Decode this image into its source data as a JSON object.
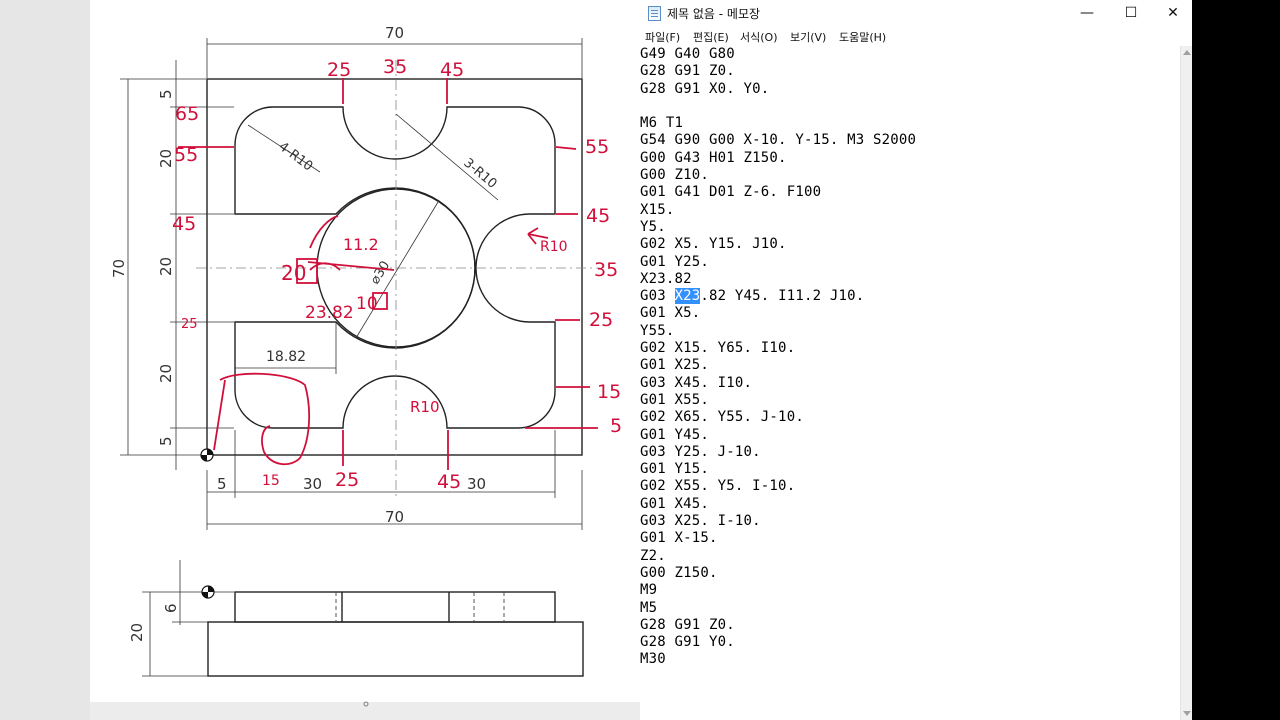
{
  "notepad": {
    "title": "제목 없음 - 메모장",
    "menu": [
      "파일(F)",
      "편집(E)",
      "서식(O)",
      "보기(V)",
      "도움말(H)"
    ],
    "window_buttons": {
      "minimize": "—",
      "maximize": "☐",
      "close": "✕"
    },
    "lines": [
      "G49 G40 G80",
      "G28 G91 Z0.",
      "G28 G91 X0. Y0.",
      "",
      "M6 T1",
      "G54 G90 G00 X-10. Y-15. M3 S2000",
      "G00 G43 H01 Z150.",
      "G00 Z10.",
      "G01 G41 D01 Z-6. F100",
      "X15.",
      "Y5.",
      "G02 X5. Y15. J10.",
      "G01 Y25.",
      "X23.82",
      "G03 X23.82 Y45. I11.2 J10.",
      "G01 X5.",
      "Y55.",
      "G02 X15. Y65. I10.",
      "G01 X25.",
      "G03 X45. I10.",
      "G01 X55.",
      "G02 X65. Y55. J-10.",
      "G01 Y45.",
      "G03 Y25. J-10.",
      "G01 Y15.",
      "G02 X55. Y5. I-10.",
      "G01 X45.",
      "G03 X25. I-10.",
      "G01 X-15.",
      "Z2.",
      "G00 Z150.",
      "M9",
      "M5",
      "G28 G91 Z0.",
      "G28 G91 Y0.",
      "M30"
    ],
    "selected_line_index": 14,
    "selection": {
      "before": "G03 ",
      "selected": "X23",
      "after": ".82 Y45. I11.2 J10."
    }
  },
  "drawing": {
    "dims": {
      "top_width": "70",
      "bottom_width": "70",
      "left_height": "70",
      "left_5_top": "5",
      "left_20_a": "20",
      "left_20_b": "20",
      "left_20_c": "20",
      "left_5_bottom": "5",
      "bottom_5": "5",
      "bottom_30_a": "30",
      "bottom_30_b": "30",
      "width_1882": "18.82",
      "radius_4r10": "4-R10",
      "radius_3r10": "3-R10",
      "dia_30": "⌀30",
      "side_6": "6",
      "side_20": "20"
    },
    "annotations": {
      "top_25": "25",
      "top_35": "35",
      "top_45": "45",
      "left_65": "65",
      "left_55": "55",
      "left_45": "45",
      "left_25": "25",
      "right_55": "55",
      "right_45": "45",
      "right_35": "35",
      "right_25": "25",
      "right_15": "15",
      "right_5": "5",
      "bottom_15": "15",
      "bottom_25": "25",
      "bottom_45": "45",
      "r10_right": "R10",
      "r10_bottom": "R10",
      "mid_112": "11.2",
      "mid_20": "20",
      "mid_2382": "23.82",
      "mid_10": "10"
    },
    "colors": {
      "annotation": "#d0103a",
      "line": "#222222"
    }
  }
}
